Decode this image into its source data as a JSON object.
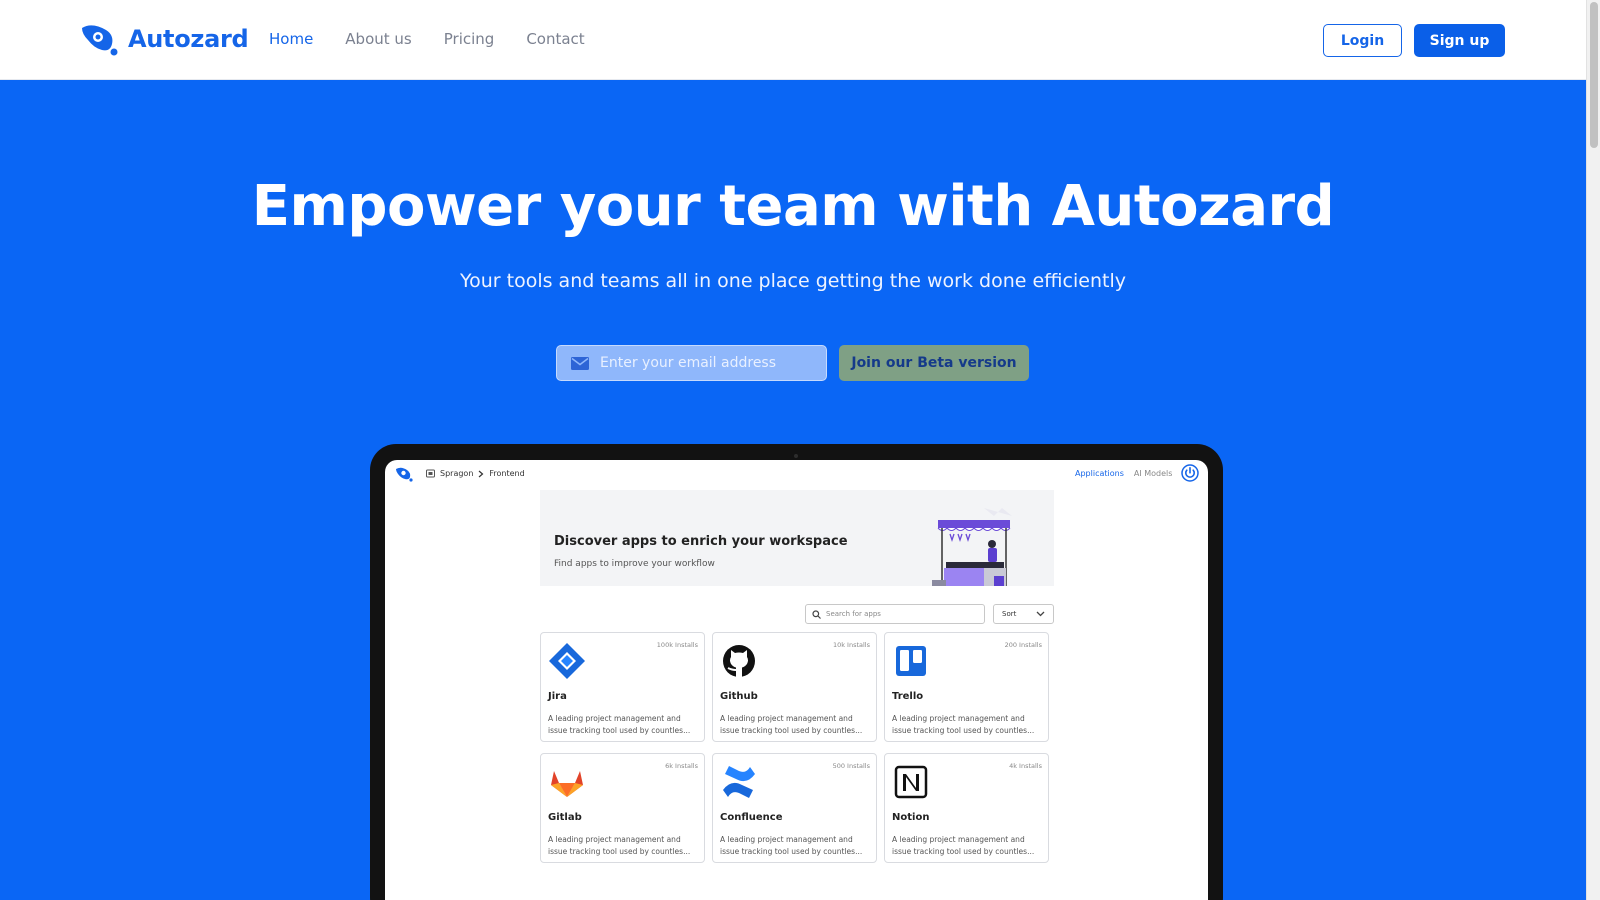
{
  "brand": {
    "name": "Autozard",
    "color": "#1565e8"
  },
  "nav": {
    "links": [
      {
        "label": "Home",
        "active": true
      },
      {
        "label": "About us",
        "active": false
      },
      {
        "label": "Pricing",
        "active": false
      },
      {
        "label": "Contact",
        "active": false
      }
    ],
    "login_label": "Login",
    "signup_label": "Sign up"
  },
  "hero": {
    "title": "Empower your team with Autozard",
    "subtitle": "Your tools and teams all in one place getting the work done efficiently",
    "email_placeholder": "Enter your email address",
    "email_icon": "envelope-icon",
    "cta_label": "Join our Beta version",
    "background_color": "#0a66f5"
  },
  "app_preview": {
    "breadcrumb": [
      "Spragon",
      "Frontend"
    ],
    "tabs": [
      {
        "label": "Applications",
        "active": true
      },
      {
        "label": "AI Models",
        "active": false
      }
    ],
    "banner": {
      "title": "Discover apps to enrich your workspace",
      "subtitle": "Find apps to improve your workflow"
    },
    "search_placeholder": "Search for apps",
    "sort_label": "Sort",
    "apps": [
      {
        "name": "Jira",
        "installs": "100k Installs",
        "icon": "jira-icon",
        "desc_line1": "A leading project management and",
        "desc_line2": "issue tracking tool used by countles..."
      },
      {
        "name": "Github",
        "installs": "10k Installs",
        "icon": "github-icon",
        "desc_line1": "A leading project management and",
        "desc_line2": "issue tracking tool used by countles..."
      },
      {
        "name": "Trello",
        "installs": "200 Installs",
        "icon": "trello-icon",
        "desc_line1": "A leading project management and",
        "desc_line2": "issue tracking tool used by countles..."
      },
      {
        "name": "Gitlab",
        "installs": "6k Installs",
        "icon": "gitlab-icon",
        "desc_line1": "A leading project management and",
        "desc_line2": "issue tracking tool used by countles..."
      },
      {
        "name": "Confluence",
        "installs": "500 Installs",
        "icon": "confluence-icon",
        "desc_line1": "A leading project management and",
        "desc_line2": "issue tracking tool used by countles..."
      },
      {
        "name": "Notion",
        "installs": "4k Installs",
        "icon": "notion-icon",
        "desc_line1": "A leading project management and",
        "desc_line2": "issue tracking tool used by countles..."
      }
    ]
  }
}
